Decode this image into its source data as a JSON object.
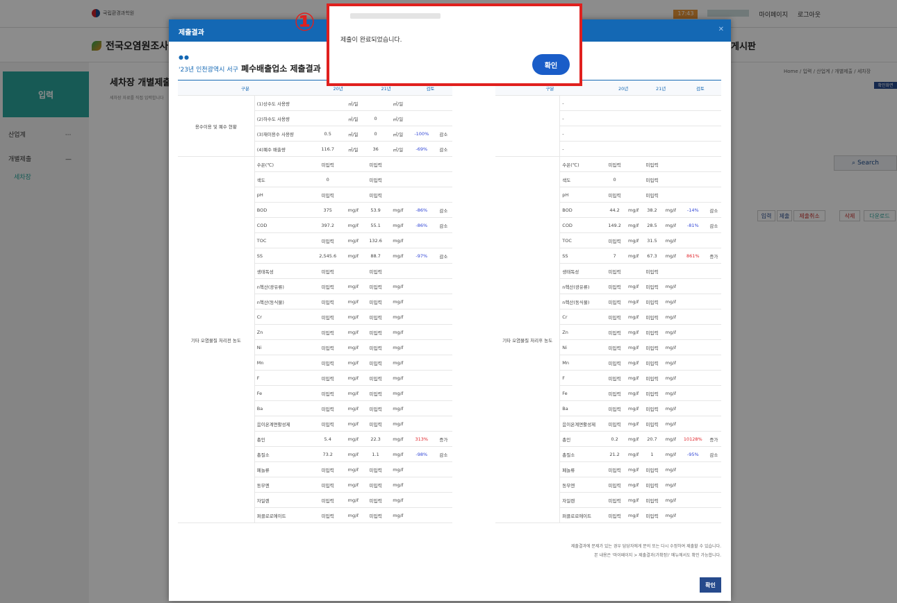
{
  "topbar": {
    "gov_text": "국립환경과학원",
    "count": "17:43",
    "mypage": "마이페이지",
    "logout": "로그아웃"
  },
  "site": {
    "title": "전국오염원조사",
    "board": "게시판"
  },
  "sidebar": {
    "head": "입력",
    "items": [
      {
        "label": "산업계",
        "sym": "···"
      },
      {
        "label": "개별제출",
        "sym": "—"
      },
      {
        "label": "세차장",
        "sym": ""
      }
    ]
  },
  "page": {
    "title": "세차장 개별제출",
    "subtitle": "세차장 자료를 직접 입력합니다",
    "breadcrumb": "Home / 입력 / 산업계 / 개별제출 / 세차장",
    "badge": "확인화면",
    "search": "Search"
  },
  "actions": [
    {
      "label": "입력",
      "color": "#264a8c"
    },
    {
      "label": "제출",
      "color": "#264a8c"
    },
    {
      "label": "제출취소",
      "color": "#c9302c"
    },
    {
      "label": "삭제",
      "color": "#c9302c"
    },
    {
      "label": "다운로드",
      "color": "#2aa59b"
    }
  ],
  "modal": {
    "header": "제출결과",
    "dots": "●●",
    "title_highlight": "'23년 인천광역시 서구",
    "title": "폐수배출업소 제출결과",
    "headers": {
      "div": "구분",
      "y20": "20년",
      "y21": "21년",
      "diff": "검토"
    },
    "footnote1": "제출결과에 문제가 있는 경우 담당자에게 문의 또는 다시 수정하여 제출할 수 있습니다.",
    "footnote2": "본 내용은 '마이페이지 > 제출결과(가확정)' 메뉴에서도 확인 가능합니다.",
    "ok": "확인"
  },
  "groups": {
    "water": "용수이용 및 폐수 현황",
    "left_pollutant": "기타 오염물질 처리전 농도",
    "right_pollutant": "기타 오염물질 처리후 농도"
  },
  "water_rows": [
    {
      "name": "(1)상수도 사용량",
      "v20": "",
      "u20": "㎥/일",
      "v21": "",
      "u21": "㎥/일",
      "pct": "",
      "trend": "",
      "cls": ""
    },
    {
      "name": "(2)하수도 사용량",
      "v20": "",
      "u20": "㎥/일",
      "v21": "0",
      "u21": "㎥/일",
      "pct": "",
      "trend": "",
      "cls": ""
    },
    {
      "name": "(3)재이용수 사용량",
      "v20": "0.5",
      "u20": "㎥/일",
      "v21": "0",
      "u21": "㎥/일",
      "pct": "-100%",
      "trend": "감소",
      "cls": "blue"
    },
    {
      "name": "(4)폐수 배출량",
      "v20": "116.7",
      "u20": "㎥/일",
      "v21": "36",
      "u21": "㎥/일",
      "pct": "-69%",
      "trend": "감소",
      "cls": "blue"
    }
  ],
  "left_rows": [
    {
      "name": "수온(℃)",
      "v20": "미입력",
      "u20": "",
      "v21": "미입력",
      "u21": "",
      "pct": "",
      "trend": "",
      "cls": ""
    },
    {
      "name": "색도",
      "v20": "0",
      "u20": "",
      "v21": "미입력",
      "u21": "",
      "pct": "",
      "trend": "",
      "cls": ""
    },
    {
      "name": "pH",
      "v20": "미입력",
      "u20": "",
      "v21": "미입력",
      "u21": "",
      "pct": "",
      "trend": "",
      "cls": ""
    },
    {
      "name": "BOD",
      "v20": "375",
      "u20": "mg/ℓ",
      "v21": "53.9",
      "u21": "mg/ℓ",
      "pct": "-86%",
      "trend": "감소",
      "cls": "blue"
    },
    {
      "name": "COD",
      "v20": "397.2",
      "u20": "mg/ℓ",
      "v21": "55.1",
      "u21": "mg/ℓ",
      "pct": "-86%",
      "trend": "감소",
      "cls": "blue"
    },
    {
      "name": "TOC",
      "v20": "미입력",
      "u20": "mg/ℓ",
      "v21": "132.6",
      "u21": "mg/ℓ",
      "pct": "",
      "trend": "",
      "cls": ""
    },
    {
      "name": "SS",
      "v20": "2,545.6",
      "u20": "mg/ℓ",
      "v21": "88.7",
      "u21": "mg/ℓ",
      "pct": "-97%",
      "trend": "감소",
      "cls": "blue"
    },
    {
      "name": "생태독성",
      "v20": "미입력",
      "u20": "",
      "v21": "미입력",
      "u21": "",
      "pct": "",
      "trend": "",
      "cls": ""
    },
    {
      "name": "n헥산(광유류)",
      "v20": "미입력",
      "u20": "mg/ℓ",
      "v21": "미입력",
      "u21": "mg/ℓ",
      "pct": "",
      "trend": "",
      "cls": ""
    },
    {
      "name": "n헥산(동식물)",
      "v20": "미입력",
      "u20": "mg/ℓ",
      "v21": "미입력",
      "u21": "mg/ℓ",
      "pct": "",
      "trend": "",
      "cls": ""
    },
    {
      "name": "Cr",
      "v20": "미입력",
      "u20": "mg/ℓ",
      "v21": "미입력",
      "u21": "mg/ℓ",
      "pct": "",
      "trend": "",
      "cls": ""
    },
    {
      "name": "Zn",
      "v20": "미입력",
      "u20": "mg/ℓ",
      "v21": "미입력",
      "u21": "mg/ℓ",
      "pct": "",
      "trend": "",
      "cls": ""
    },
    {
      "name": "Ni",
      "v20": "미입력",
      "u20": "mg/ℓ",
      "v21": "미입력",
      "u21": "mg/ℓ",
      "pct": "",
      "trend": "",
      "cls": ""
    },
    {
      "name": "Mn",
      "v20": "미입력",
      "u20": "mg/ℓ",
      "v21": "미입력",
      "u21": "mg/ℓ",
      "pct": "",
      "trend": "",
      "cls": ""
    },
    {
      "name": "F",
      "v20": "미입력",
      "u20": "mg/ℓ",
      "v21": "미입력",
      "u21": "mg/ℓ",
      "pct": "",
      "trend": "",
      "cls": ""
    },
    {
      "name": "Fe",
      "v20": "미입력",
      "u20": "mg/ℓ",
      "v21": "미입력",
      "u21": "mg/ℓ",
      "pct": "",
      "trend": "",
      "cls": ""
    },
    {
      "name": "Ba",
      "v20": "미입력",
      "u20": "mg/ℓ",
      "v21": "미입력",
      "u21": "mg/ℓ",
      "pct": "",
      "trend": "",
      "cls": ""
    },
    {
      "name": "음이온계면활성제",
      "v20": "미입력",
      "u20": "mg/ℓ",
      "v21": "미입력",
      "u21": "mg/ℓ",
      "pct": "",
      "trend": "",
      "cls": ""
    },
    {
      "name": "총인",
      "v20": "5.4",
      "u20": "mg/ℓ",
      "v21": "22.3",
      "u21": "mg/ℓ",
      "pct": "313%",
      "trend": "증가",
      "cls": "red"
    },
    {
      "name": "총질소",
      "v20": "73.2",
      "u20": "mg/ℓ",
      "v21": "1.1",
      "u21": "mg/ℓ",
      "pct": "-98%",
      "trend": "감소",
      "cls": "blue"
    },
    {
      "name": "페놀류",
      "v20": "미입력",
      "u20": "mg/ℓ",
      "v21": "미입력",
      "u21": "mg/ℓ",
      "pct": "",
      "trend": "",
      "cls": ""
    },
    {
      "name": "동무엔",
      "v20": "미입력",
      "u20": "mg/ℓ",
      "v21": "미입력",
      "u21": "mg/ℓ",
      "pct": "",
      "trend": "",
      "cls": ""
    },
    {
      "name": "자일렌",
      "v20": "미입력",
      "u20": "mg/ℓ",
      "v21": "미입력",
      "u21": "mg/ℓ",
      "pct": "",
      "trend": "",
      "cls": ""
    },
    {
      "name": "퍼클로로에이트",
      "v20": "미입력",
      "u20": "mg/ℓ",
      "v21": "미입력",
      "u21": "mg/ℓ",
      "pct": "",
      "trend": "",
      "cls": ""
    }
  ],
  "right_rows": [
    {
      "name": "수온(℃)",
      "v20": "미입력",
      "u20": "",
      "v21": "미입력",
      "u21": "",
      "pct": "",
      "trend": "",
      "cls": ""
    },
    {
      "name": "색도",
      "v20": "0",
      "u20": "",
      "v21": "미입력",
      "u21": "",
      "pct": "",
      "trend": "",
      "cls": ""
    },
    {
      "name": "pH",
      "v20": "미입력",
      "u20": "",
      "v21": "미입력",
      "u21": "",
      "pct": "",
      "trend": "",
      "cls": ""
    },
    {
      "name": "BOD",
      "v20": "44.2",
      "u20": "mg/ℓ",
      "v21": "38.2",
      "u21": "mg/ℓ",
      "pct": "-14%",
      "trend": "감소",
      "cls": "blue"
    },
    {
      "name": "COD",
      "v20": "149.2",
      "u20": "mg/ℓ",
      "v21": "28.5",
      "u21": "mg/ℓ",
      "pct": "-81%",
      "trend": "감소",
      "cls": "blue"
    },
    {
      "name": "TOC",
      "v20": "미입력",
      "u20": "mg/ℓ",
      "v21": "31.5",
      "u21": "mg/ℓ",
      "pct": "",
      "trend": "",
      "cls": ""
    },
    {
      "name": "SS",
      "v20": "7",
      "u20": "mg/ℓ",
      "v21": "67.3",
      "u21": "mg/ℓ",
      "pct": "861%",
      "trend": "증가",
      "cls": "red"
    },
    {
      "name": "생태독성",
      "v20": "미입력",
      "u20": "",
      "v21": "미입력",
      "u21": "",
      "pct": "",
      "trend": "",
      "cls": ""
    },
    {
      "name": "n헥산(광유류)",
      "v20": "미입력",
      "u20": "mg/ℓ",
      "v21": "미입력",
      "u21": "mg/ℓ",
      "pct": "",
      "trend": "",
      "cls": ""
    },
    {
      "name": "n헥산(동식물)",
      "v20": "미입력",
      "u20": "mg/ℓ",
      "v21": "미입력",
      "u21": "mg/ℓ",
      "pct": "",
      "trend": "",
      "cls": ""
    },
    {
      "name": "Cr",
      "v20": "미입력",
      "u20": "mg/ℓ",
      "v21": "미입력",
      "u21": "mg/ℓ",
      "pct": "",
      "trend": "",
      "cls": ""
    },
    {
      "name": "Zn",
      "v20": "미입력",
      "u20": "mg/ℓ",
      "v21": "미입력",
      "u21": "mg/ℓ",
      "pct": "",
      "trend": "",
      "cls": ""
    },
    {
      "name": "Ni",
      "v20": "미입력",
      "u20": "mg/ℓ",
      "v21": "미입력",
      "u21": "mg/ℓ",
      "pct": "",
      "trend": "",
      "cls": ""
    },
    {
      "name": "Mn",
      "v20": "미입력",
      "u20": "mg/ℓ",
      "v21": "미입력",
      "u21": "mg/ℓ",
      "pct": "",
      "trend": "",
      "cls": ""
    },
    {
      "name": "F",
      "v20": "미입력",
      "u20": "mg/ℓ",
      "v21": "미입력",
      "u21": "mg/ℓ",
      "pct": "",
      "trend": "",
      "cls": ""
    },
    {
      "name": "Fe",
      "v20": "미입력",
      "u20": "mg/ℓ",
      "v21": "미입력",
      "u21": "mg/ℓ",
      "pct": "",
      "trend": "",
      "cls": ""
    },
    {
      "name": "Ba",
      "v20": "미입력",
      "u20": "mg/ℓ",
      "v21": "미입력",
      "u21": "mg/ℓ",
      "pct": "",
      "trend": "",
      "cls": ""
    },
    {
      "name": "음이온계면활성제",
      "v20": "미입력",
      "u20": "mg/ℓ",
      "v21": "미입력",
      "u21": "mg/ℓ",
      "pct": "",
      "trend": "",
      "cls": ""
    },
    {
      "name": "총인",
      "v20": "0.2",
      "u20": "mg/ℓ",
      "v21": "20.7",
      "u21": "mg/ℓ",
      "pct": "10128%",
      "trend": "증가",
      "cls": "red"
    },
    {
      "name": "총질소",
      "v20": "21.2",
      "u20": "mg/ℓ",
      "v21": "1",
      "u21": "mg/ℓ",
      "pct": "-95%",
      "trend": "감소",
      "cls": "blue"
    },
    {
      "name": "페놀류",
      "v20": "미입력",
      "u20": "mg/ℓ",
      "v21": "미입력",
      "u21": "mg/ℓ",
      "pct": "",
      "trend": "",
      "cls": ""
    },
    {
      "name": "동무엔",
      "v20": "미입력",
      "u20": "mg/ℓ",
      "v21": "미입력",
      "u21": "mg/ℓ",
      "pct": "",
      "trend": "",
      "cls": ""
    },
    {
      "name": "자일렌",
      "v20": "미입력",
      "u20": "mg/ℓ",
      "v21": "미입력",
      "u21": "mg/ℓ",
      "pct": "",
      "trend": "",
      "cls": ""
    },
    {
      "name": "퍼클로로에이트",
      "v20": "미입력",
      "u20": "mg/ℓ",
      "v21": "미입력",
      "u21": "mg/ℓ",
      "pct": "",
      "trend": "",
      "cls": ""
    }
  ],
  "alert": {
    "message": "제출이 완료되었습니다.",
    "ok": "확인",
    "marker": "①"
  }
}
